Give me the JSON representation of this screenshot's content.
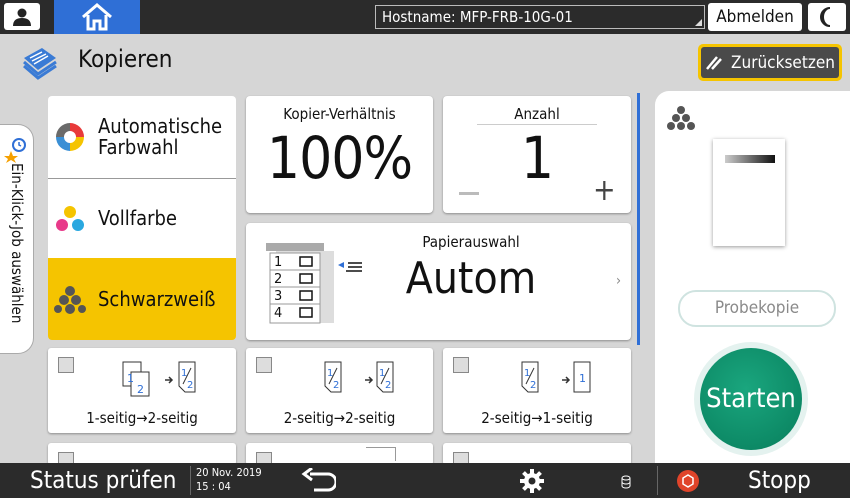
{
  "topbar": {
    "hostname": "Hostname: MFP-FRB-10G-01",
    "logout_label": "Abmelden"
  },
  "header": {
    "title": "Kopieren",
    "reset_label": "Zurücksetzen"
  },
  "side_tab": {
    "label": "Ein-Klick-Job auswählen"
  },
  "color_modes": [
    {
      "label": "Automatische\nFarbwahl",
      "selected": false
    },
    {
      "label": "Vollfarbe",
      "selected": false
    },
    {
      "label": "Schwarzweiß",
      "selected": true
    }
  ],
  "ratio": {
    "title": "Kopier-Verhältnis",
    "value": "100%"
  },
  "count": {
    "title": "Anzahl",
    "value": "1"
  },
  "paper": {
    "title": "Papierauswahl",
    "value": "Autom",
    "trays": [
      "1",
      "2",
      "3",
      "4"
    ]
  },
  "duplex": [
    {
      "label": "1-seitig→2-seitig"
    },
    {
      "label": "2-seitig→2-seitig"
    },
    {
      "label": "2-seitig→1-seitig"
    }
  ],
  "right": {
    "probe_label": "Probekopie",
    "start_label": "Starten"
  },
  "bottombar": {
    "status_label": "Status prüfen",
    "date": "20 Nov. 2019",
    "time": "15 : 04",
    "stop_label": "Stopp"
  },
  "colors": {
    "accent_blue": "#2f6fd6",
    "selected_yellow": "#f5c400",
    "start_green": "#0d8a66"
  }
}
